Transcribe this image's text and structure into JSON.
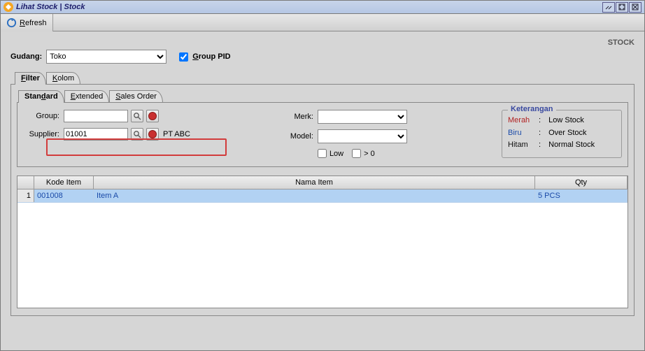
{
  "window": {
    "title": "Lihat Stock | Stock"
  },
  "toolbar": {
    "refresh": "Refresh"
  },
  "header": {
    "stock": "STOCK"
  },
  "top": {
    "gudang_label": "Gudang:",
    "gudang_value": "Toko",
    "group_pid_label": "Group PID",
    "group_pid_checked": true
  },
  "tabs_outer": {
    "filter": "Filter",
    "kolom": "Kolom"
  },
  "tabs_inner": {
    "standard": "Standard",
    "extended": "Extended",
    "sales_order": "Sales Order"
  },
  "filter": {
    "group_label": "Group:",
    "group_value": "",
    "supplier_label": "Supplier:",
    "supplier_value": "01001",
    "supplier_name": "PT ABC",
    "merk_label": "Merk:",
    "merk_value": "",
    "model_label": "Model:",
    "model_value": "",
    "low_label": "Low",
    "low_checked": false,
    "gt0_label": "> 0",
    "gt0_checked": false
  },
  "keterangan": {
    "legend": "Keterangan",
    "rows": [
      {
        "color_label": "Merah",
        "colon": ":",
        "desc": "Low Stock"
      },
      {
        "color_label": "Biru",
        "colon": ":",
        "desc": "Over Stock"
      },
      {
        "color_label": "Hitam",
        "colon": ":",
        "desc": "Normal Stock"
      }
    ]
  },
  "grid": {
    "columns": {
      "rownum": "",
      "kode": "Kode Item",
      "nama": "Nama Item",
      "qty": "Qty"
    },
    "rows": [
      {
        "n": "1",
        "kode": "001008",
        "nama": "Item A",
        "qty": "5 PCS",
        "status": "over"
      }
    ]
  }
}
